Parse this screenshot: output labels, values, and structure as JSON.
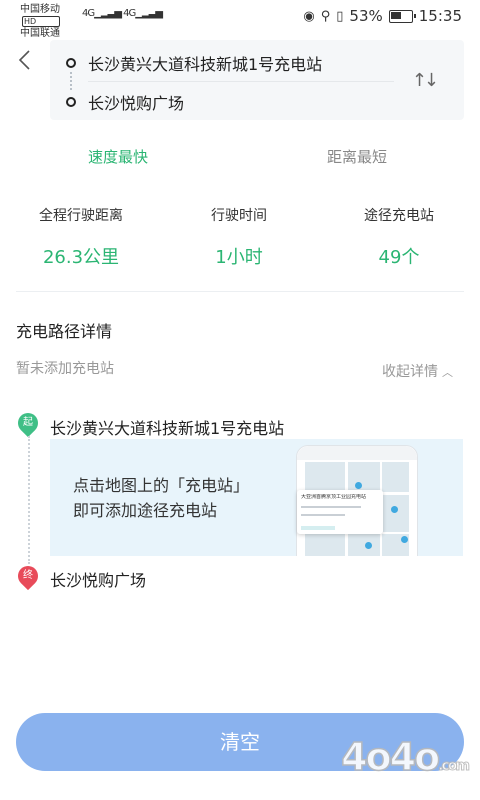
{
  "status_bar": {
    "carrier1": "中国移动",
    "hd_badge": "HD",
    "carrier2": "中国联通",
    "network1": "4G",
    "network2": "4G",
    "battery_percent": "53%",
    "time": "15:35"
  },
  "route": {
    "origin": "长沙黄兴大道科技新城1号充电站",
    "destination": "长沙悦购广场",
    "swap_icon": "swap-vertical-icon"
  },
  "tabs": [
    {
      "label": "速度最快",
      "active": true
    },
    {
      "label": "距离最短",
      "active": false
    }
  ],
  "stats": [
    {
      "label": "全程行驶距离",
      "value": "26.3公里"
    },
    {
      "label": "行驶时间",
      "value": "1小时"
    },
    {
      "label": "途径充电站",
      "value": "49个"
    }
  ],
  "details": {
    "title": "充电路径详情",
    "empty_hint": "暂未添加充电站",
    "collapse_label": "收起详情",
    "start_pin": "起",
    "end_pin": "终",
    "start_name": "长沙黄兴大道科技新城1号充电站",
    "end_name": "长沙悦购广场",
    "promo_line1": "点击地图上的「充电站」",
    "promo_line2": "即可添加途径充电站",
    "promo_card_title": "大亚洲首腾京顶工业园充电站"
  },
  "clear_button": "清空",
  "watermark": "4o4o",
  "watermark_suffix": ".com",
  "colors": {
    "accent_green": "#2bb573",
    "start_green": "#3fbf86",
    "end_red": "#e84b5a",
    "button_blue": "#8ab2ee"
  }
}
